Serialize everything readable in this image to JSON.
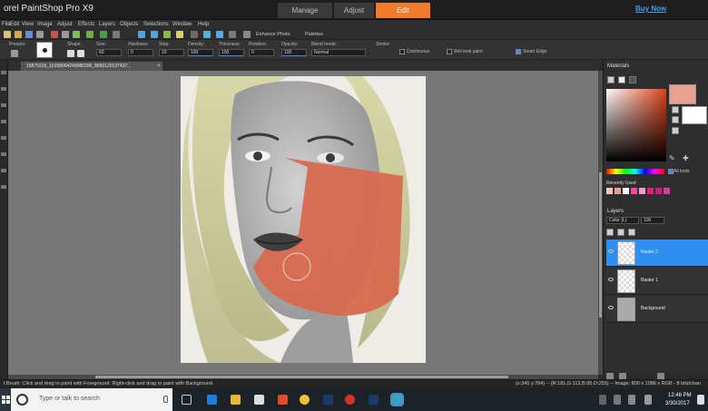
{
  "app": {
    "title": "orel PaintShop Pro X9"
  },
  "mode_tabs": [
    "Manage",
    "Adjust",
    "Edit"
  ],
  "buy_now": "Buy Now",
  "menu": [
    "File",
    "Edit",
    "View",
    "Image",
    "Adjust",
    "Effects",
    "Layers",
    "Objects",
    "Selections",
    "Window",
    "Help"
  ],
  "toolbar": {
    "enhance_photo": "Enhance Photo",
    "palettes": "Palettes"
  },
  "options": {
    "presets_label": "Presets:",
    "shape_label": "Shape:",
    "size_label": "Size:",
    "size_value": "60",
    "hardness_label": "Hardness:",
    "hardness_value": "0",
    "step_label": "Step:",
    "step_value": "10",
    "density_label": "Density:",
    "density_value": "100",
    "thickness_label": "Thickness:",
    "thickness_value": "100",
    "rotation_label": "Rotation:",
    "rotation_value": "0",
    "opacity_label": "Opacity:",
    "opacity_value": "100",
    "blend_label": "Blend mode:",
    "blend_value": "Normal",
    "stroke_label": "Stroke:",
    "continuous_label": "Continuous",
    "wetlook_label": "Wet look paint",
    "smartedge_label": "Smart Edge"
  },
  "document": {
    "tab_title": "15875316_10158064249080296_8650120137437...",
    "close": "×"
  },
  "materials": {
    "header": "Materials",
    "all_tools": "All tools",
    "recently_used": "Recently Used",
    "fg_color": "#e8a090",
    "bg_color": "#ffffff"
  },
  "recent_colors": [
    "#f6c4b8",
    "#e8a090",
    "#ffffff",
    "#ff44aa",
    "#f0a0c8",
    "#dd2277",
    "#c81e8c",
    "#e03aa0"
  ],
  "layers": {
    "header": "Layers",
    "blend": "Color (L)",
    "opacity": "100",
    "items": [
      {
        "name": "Raster 2",
        "selected": true
      },
      {
        "name": "Raster 1",
        "selected": false
      },
      {
        "name": "Background",
        "selected": false
      }
    ]
  },
  "status": {
    "left": "t Brush: Click and drag to paint with Foreground. Right-click and drag to paint with Background.",
    "right": "(x:345 y:784) -- (R:181,G:113,B:95,O:255) -- Image: 800 x 1086 x RGB - 8 bits/chan"
  },
  "taskbar": {
    "search_placeholder": "Type or talk to search",
    "time": "12:46 PM",
    "date": "3/30/2017"
  },
  "accent": "#f07b2a",
  "selection_color": "#2e8ff0"
}
